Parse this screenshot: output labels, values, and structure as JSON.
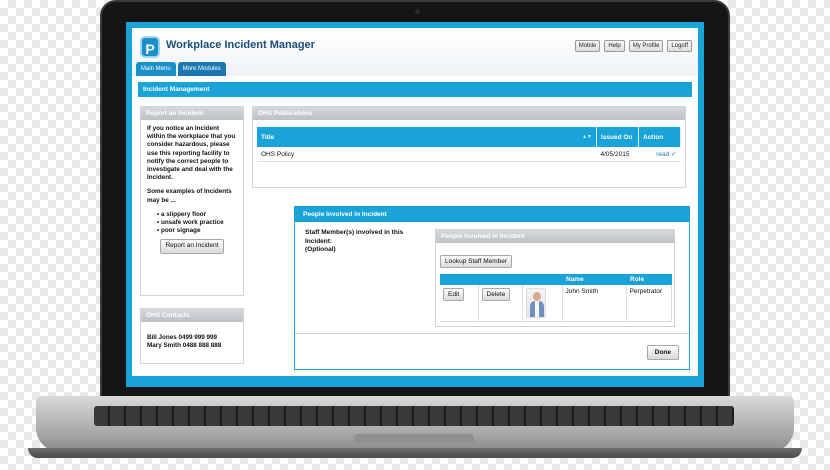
{
  "app": {
    "logo_letter": "P",
    "title": "Workplace Incident Manager",
    "top_links": [
      "Mobile",
      "Help",
      "My Profile",
      "Logoff"
    ],
    "tabs": [
      {
        "label": "Main Menu",
        "active": true
      },
      {
        "label": "More Modules",
        "active": false
      }
    ]
  },
  "section_title": "Incident Management",
  "report_panel": {
    "title": "Report an Incident",
    "intro": "If you notice an Incident within the workplace that you consider hazardous, please use this reporting facility to notify the correct people to investigate and deal with the Incident.",
    "examples_heading": "Some examples of Incidents may be ...",
    "examples": [
      "a slippery floor",
      "unsafe work practice",
      "poor signage"
    ],
    "button": "Report an Incident"
  },
  "contacts_panel": {
    "title": "OHS Contacts",
    "contacts": [
      "Bill Jones 0499 999 999",
      "Mary Smith 0488 888 888"
    ]
  },
  "publications_panel": {
    "title": "OHS Publications",
    "columns": [
      "Title",
      "Issued On",
      "Action"
    ],
    "rows": [
      {
        "title": "OHS Policy",
        "issued_on": "4/05/2015",
        "action": "read"
      }
    ]
  },
  "modal": {
    "title": "People Involved in Incident",
    "staff_label": "Staff Member(s) involved in this Incident:",
    "optional_label": "(Optional)",
    "inner_title": "People Involved in Incident",
    "lookup_button": "Lookup Staff Member",
    "columns": [
      "",
      "",
      "",
      "Name",
      "Role"
    ],
    "rows": [
      {
        "edit": "Edit",
        "delete": "Delete",
        "name": "John Smith",
        "role": "Perpetrator"
      }
    ],
    "done_button": "Done"
  },
  "colors": {
    "accent": "#1aa3d8",
    "header_title": "#1a4e7a",
    "panel_header": "#bcc1c5"
  },
  "icons": {
    "sort": "sort-arrows-icon",
    "check": "check-icon"
  }
}
